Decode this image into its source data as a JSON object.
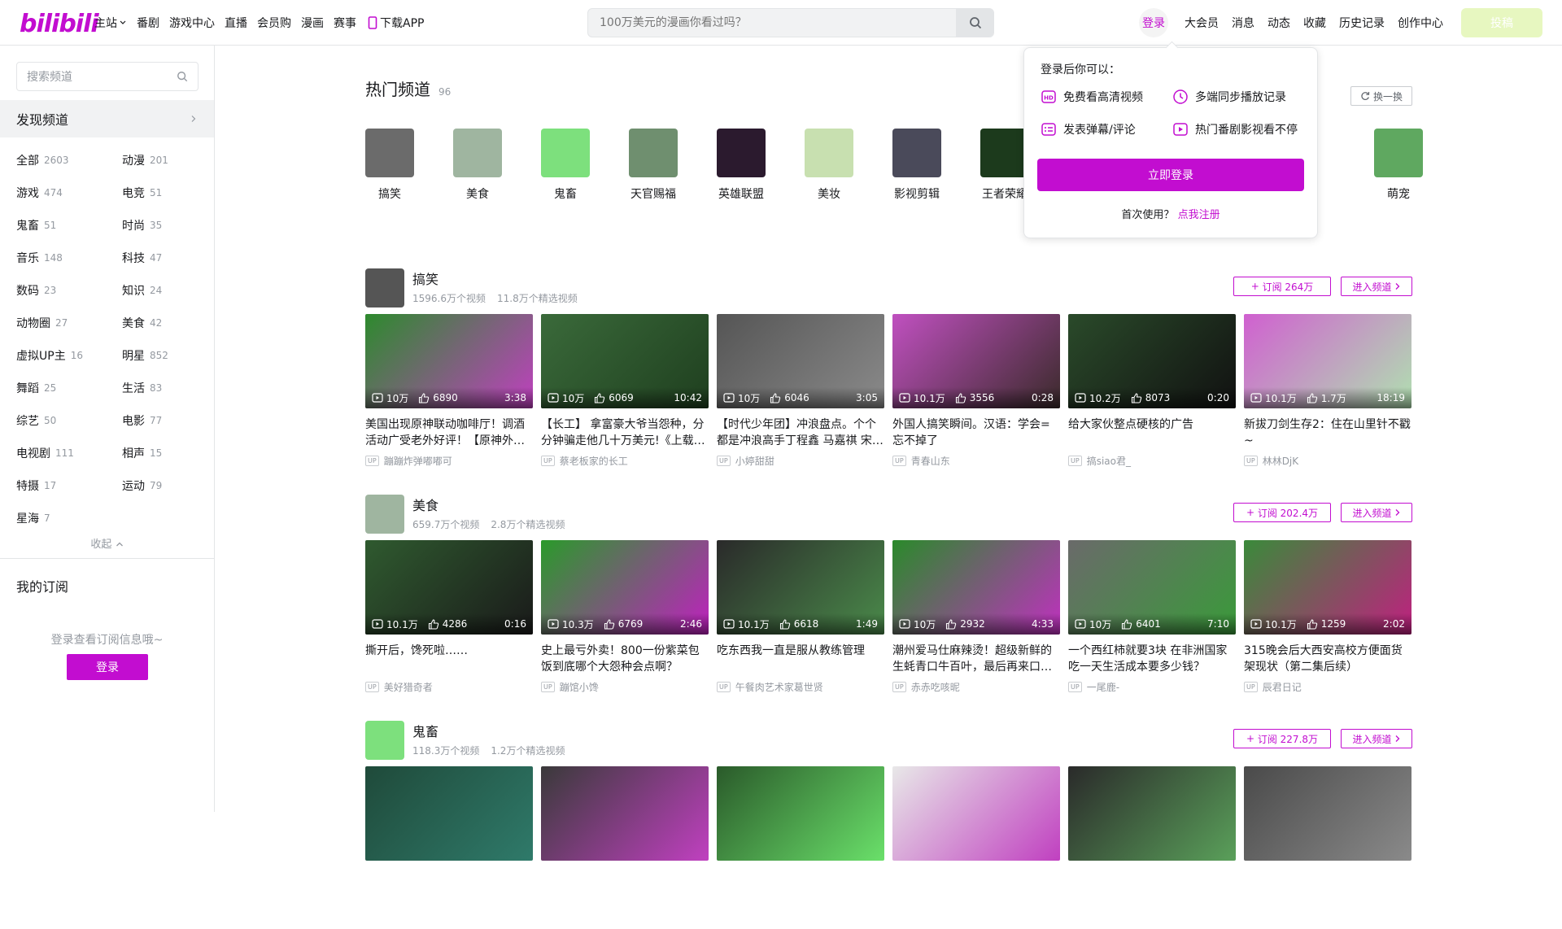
{
  "colors": {
    "accent": "#c20dd0",
    "upload_bg": "#e7f7c0"
  },
  "header": {
    "logo": "bilibili",
    "nav": [
      "主站",
      "番剧",
      "游戏中心",
      "直播",
      "会员购",
      "漫画",
      "赛事",
      "下载APP"
    ],
    "search_placeholder": "100万美元的漫画你看过吗？",
    "login": "登录",
    "right_items": [
      "大会员",
      "消息",
      "动态",
      "收藏",
      "历史记录",
      "创作中心"
    ],
    "upload": "投稿"
  },
  "sidebar": {
    "search_placeholder": "搜索频道",
    "discover": "发现频道",
    "categories": [
      {
        "name": "全部",
        "count": "2603"
      },
      {
        "name": "动漫",
        "count": "201"
      },
      {
        "name": "游戏",
        "count": "474"
      },
      {
        "name": "电竞",
        "count": "51"
      },
      {
        "name": "鬼畜",
        "count": "51"
      },
      {
        "name": "时尚",
        "count": "35"
      },
      {
        "name": "音乐",
        "count": "148"
      },
      {
        "name": "科技",
        "count": "47"
      },
      {
        "name": "数码",
        "count": "23"
      },
      {
        "name": "知识",
        "count": "24"
      },
      {
        "name": "动物圈",
        "count": "27"
      },
      {
        "name": "美食",
        "count": "42"
      },
      {
        "name": "虚拟UP主",
        "count": "16"
      },
      {
        "name": "明星",
        "count": "852"
      },
      {
        "name": "舞蹈",
        "count": "25"
      },
      {
        "name": "生活",
        "count": "83"
      },
      {
        "name": "综艺",
        "count": "50"
      },
      {
        "name": "电影",
        "count": "77"
      },
      {
        "name": "电视剧",
        "count": "111"
      },
      {
        "name": "相声",
        "count": "15"
      },
      {
        "name": "特摄",
        "count": "17"
      },
      {
        "name": "运动",
        "count": "79"
      },
      {
        "name": "星海",
        "count": "7"
      }
    ],
    "collapse": "收起",
    "my_subscriptions": "我的订阅",
    "sub_hint": "登录查看订阅信息哦~",
    "login_btn": "登录"
  },
  "main": {
    "title": "热门频道",
    "title_count": "96",
    "refresh": "换一换",
    "hot_channels": [
      {
        "name": "搞笑",
        "color": "#6b6b6b"
      },
      {
        "name": "美食",
        "color": "#9fb5a0"
      },
      {
        "name": "鬼畜",
        "color": "#7de07d"
      },
      {
        "name": "天官赐福",
        "color": "#6f8f6f"
      },
      {
        "name": "英雄联盟",
        "color": "#2b1a2e"
      },
      {
        "name": "美妆",
        "color": "#c8e0b0"
      },
      {
        "name": "影视剪辑",
        "color": "#4a4a5a"
      },
      {
        "name": "王者荣耀",
        "color": "#1c3a1c"
      },
      {
        "name": "萌宠",
        "color": "#5fa860"
      }
    ]
  },
  "sections": [
    {
      "name": "搞笑",
      "videos_count": "1596.6万个视频",
      "featured": "11.8万个精选视频",
      "subscribe": "订阅 264万",
      "enter": "进入频道",
      "avatar_color": "#555",
      "videos": [
        {
          "views": "10万",
          "likes": "6890",
          "dur": "3:38",
          "title": "美国出现原神联动咖啡厅！调酒活动广受老外好评！【原神外网热评】",
          "up": "蹦蹦炸弹嘟嘟可",
          "c1": "#2d8a2d",
          "c2": "#c040c0"
        },
        {
          "views": "10万",
          "likes": "6069",
          "dur": "10:42",
          "title": "【长工】 拿富豪大爷当怨种，分分钟骗走他几十万美元!《上载新生》",
          "up": "蔡老板家的长工",
          "c1": "#3a6a3a",
          "c2": "#1f3f1f"
        },
        {
          "views": "10万",
          "likes": "6046",
          "dur": "3:05",
          "title": "【时代少年团】冲浪盘点。个个都是冲浪高手丁程鑫 马嘉祺 宋亚轩",
          "up": "小婷甜甜",
          "c1": "#555",
          "c2": "#8a8a8a"
        },
        {
          "views": "10.1万",
          "likes": "3556",
          "dur": "0:28",
          "title": "外国人搞笑瞬间。汉语：学会=忘不掉了",
          "up": "青春山东",
          "c1": "#c050c0",
          "c2": "#3a2a2a"
        },
        {
          "views": "10.2万",
          "likes": "8073",
          "dur": "0:20",
          "title": "给大家伙整点硬核的广告",
          "up": "搞siao君_",
          "c1": "#2a4a2a",
          "c2": "#111"
        },
        {
          "views": "10.1万",
          "likes": "1.7万",
          "dur": "18:19",
          "title": "新拔刀剑生存2：住在山里针不戳~",
          "up": "林林DjK",
          "c1": "#d060d0",
          "c2": "#b0e0b0"
        }
      ]
    },
    {
      "name": "美食",
      "videos_count": "659.7万个视频",
      "featured": "2.8万个精选视频",
      "subscribe": "订阅 202.4万",
      "enter": "进入频道",
      "avatar_color": "#9fb5a0",
      "videos": [
        {
          "views": "10.1万",
          "likes": "4286",
          "dur": "0:16",
          "title": "撕开后，馋死啦……",
          "up": "美好猎奇者",
          "c1": "#2f5a2f",
          "c2": "#1a1a1a"
        },
        {
          "views": "10.3万",
          "likes": "6769",
          "dur": "2:46",
          "title": "史上最亏外卖！800一份紫菜包饭到底哪个大怨种会点啊？",
          "up": "蹦馆小馋",
          "c1": "#2a9a2a",
          "c2": "#c020c0"
        },
        {
          "views": "10.1万",
          "likes": "6618",
          "dur": "1:49",
          "title": "吃东西我一直是服从教练管理",
          "up": "午餐肉艺术家葛世贤",
          "c1": "#2a2a2a",
          "c2": "#4a8a4a"
        },
        {
          "views": "10万",
          "likes": "2932",
          "dur": "4:33",
          "title": "潮州爱马仕麻辣烫！超级新鲜的生蚝青口牛百叶，最后再来口饭…",
          "up": "赤赤吃咳昵",
          "c1": "#2a8a2a",
          "c2": "#c030c0"
        },
        {
          "views": "10万",
          "likes": "6401",
          "dur": "7:10",
          "title": "一个西红柿就要3块 在非洲国家吃一天生活成本要多少钱？",
          "up": "一尾鹿-",
          "c1": "#6a6a6a",
          "c2": "#3a9a3a"
        },
        {
          "views": "10.1万",
          "likes": "1259",
          "dur": "2:02",
          "title": "315晚会后大西安高校方便面货架现状（第二集后续）",
          "up": "辰君日记",
          "c1": "#3a8a3a",
          "c2": "#c02080"
        }
      ]
    },
    {
      "name": "鬼畜",
      "videos_count": "118.3万个视频",
      "featured": "1.2万个精选视频",
      "subscribe": "订阅 227.8万",
      "enter": "进入频道",
      "avatar_color": "#7de07d",
      "videos": [
        {
          "c1": "#1f4a3a",
          "c2": "#2f7a6a"
        },
        {
          "c1": "#3a3a3a",
          "c2": "#c040c0"
        },
        {
          "c1": "#2a5a2a",
          "c2": "#6ae06a"
        },
        {
          "c1": "#e8e8e8",
          "c2": "#c040c0"
        },
        {
          "c1": "#2a2a2a",
          "c2": "#5aa05a"
        },
        {
          "c1": "#4a4a4a",
          "c2": "#8a8a8a"
        }
      ]
    }
  ],
  "popup": {
    "header": "登录后你可以：",
    "perks": [
      "免费看高清视频",
      "多端同步播放记录",
      "发表弹幕/评论",
      "热门番剧影视看不停"
    ],
    "login_btn": "立即登录",
    "first_use": "首次使用？",
    "register": "点我注册"
  }
}
